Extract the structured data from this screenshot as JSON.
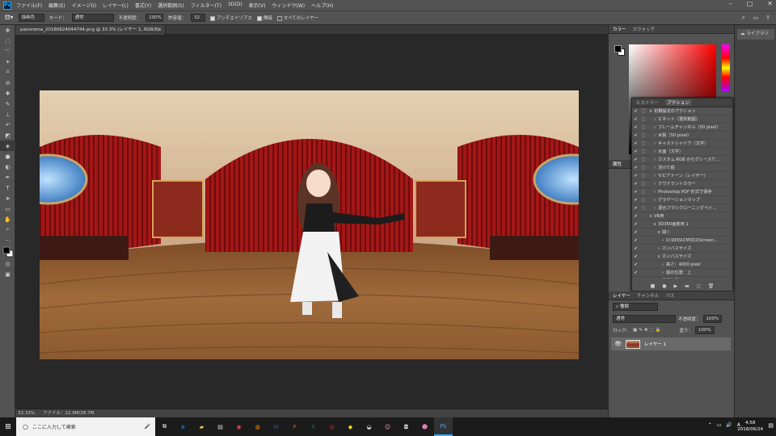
{
  "app": {
    "logo": "Ps"
  },
  "menu": [
    "ファイル(F)",
    "編集(E)",
    "イメージ(I)",
    "レイヤー(L)",
    "書式(Y)",
    "選択範囲(S)",
    "フィルター(T)",
    "3D(D)",
    "表示(V)",
    "ウィンドウ(W)",
    "ヘルプ(H)"
  ],
  "options": {
    "fill_source": "描画色",
    "mode_label": "モード：",
    "mode_value": "通常",
    "opacity_label": "不透明度：",
    "opacity_value": "100%",
    "tolerance_label": "許容値：",
    "tolerance_value": "32",
    "antialias": "アンチエイリアス",
    "contiguous": "隣接",
    "all_layers": "すべてのレイヤー"
  },
  "document": {
    "tab_title": "panorama_20180624044744.png @ 33.3% (レイヤー 1, RGB/8)",
    "tab_close": "×",
    "zoom": "33.33%",
    "file_info": "ファイル：22.9M/28.7M"
  },
  "color_panel": {
    "tabs": [
      "カラー",
      "スウォッチ"
    ]
  },
  "library": {
    "label": "ライブラリ"
  },
  "history": {
    "tabs": [
      "ヒストリー",
      "アクション"
    ]
  },
  "actions": [
    {
      "label": "初期設定のアクション",
      "level": 0,
      "expanded": true
    },
    {
      "label": "ビネット（選択範囲）",
      "level": 1
    },
    {
      "label": "フレームチャンネル（50 pixel）",
      "level": 1
    },
    {
      "label": "木製（50 pixel）",
      "level": 1
    },
    {
      "label": "キャストシャドウ（文字）",
      "level": 1
    },
    {
      "label": "水面（文字）",
      "level": 1
    },
    {
      "label": "カスタム RGB からグレースケ…",
      "level": 1
    },
    {
      "label": "溶けた鉛",
      "level": 1
    },
    {
      "label": "セピアトーン（レイヤー）",
      "level": 1
    },
    {
      "label": "クワドラントカラー",
      "level": 1
    },
    {
      "label": "Photoshop PDF 形式で保存",
      "level": 1
    },
    {
      "label": "グラデーションマップ",
      "level": 1
    },
    {
      "label": "混合ブラシクローニングペイ…",
      "level": 1
    },
    {
      "label": "VR用",
      "level": 0,
      "expanded": true
    },
    {
      "label": "3D360画像用 1",
      "level": 1,
      "expanded": true
    },
    {
      "label": "開く",
      "level": 2,
      "expanded": true
    },
    {
      "label": "D:\\KISS\\CM3D2\\Screen…",
      "level": 3
    },
    {
      "label": "カンバスサイズ",
      "level": 2
    },
    {
      "label": "カンバスサイズ",
      "level": 2,
      "expanded": true
    },
    {
      "label": "高さ：4000 pixel",
      "level": 3
    },
    {
      "label": "縦の位置：上",
      "level": 3
    },
    {
      "label": "選択範囲を…",
      "level": 2
    }
  ],
  "properties": {
    "tab": "属性"
  },
  "layers": {
    "tabs": [
      "レイヤー",
      "チャンネル",
      "パス"
    ],
    "filter": "種類",
    "blend": "通常",
    "opacity_label": "不透明度：",
    "opacity_value": "100%",
    "lock_label": "ロック：",
    "fill_label": "塗り：",
    "fill_value": "100%",
    "items": [
      {
        "name": "レイヤー 1"
      }
    ]
  },
  "taskbar": {
    "search_placeholder": "ここに入力して検索",
    "time": "4:58",
    "date": "2018/06/24",
    "ime": "A"
  }
}
